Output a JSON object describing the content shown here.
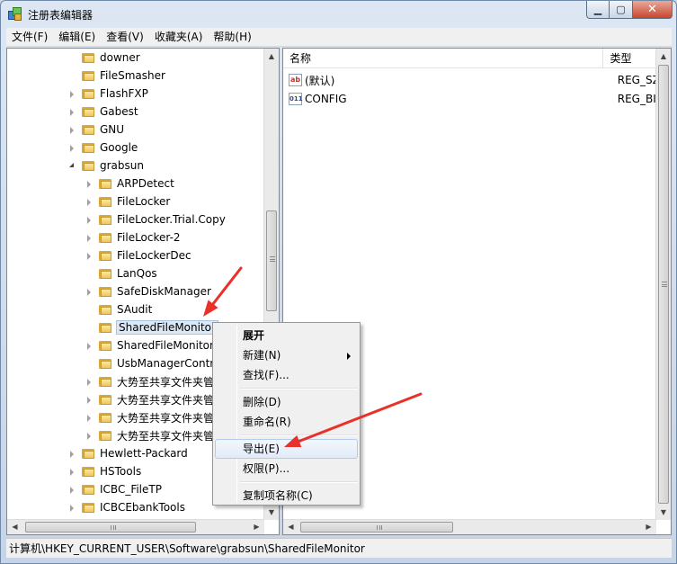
{
  "window": {
    "title": "注册表编辑器",
    "controls": {
      "minimize": "▁",
      "maximize": "▢",
      "close": "✕"
    }
  },
  "menubar": [
    {
      "label": "文件(F)"
    },
    {
      "label": "编辑(E)"
    },
    {
      "label": "查看(V)"
    },
    {
      "label": "收藏夹(A)"
    },
    {
      "label": "帮助(H)"
    }
  ],
  "tree": {
    "nodes": [
      {
        "label": "downer",
        "depth": 1,
        "expander": "none"
      },
      {
        "label": "FileSmasher",
        "depth": 1,
        "expander": "none"
      },
      {
        "label": "FlashFXP",
        "depth": 1,
        "expander": "collapsed"
      },
      {
        "label": "Gabest",
        "depth": 1,
        "expander": "collapsed"
      },
      {
        "label": "GNU",
        "depth": 1,
        "expander": "collapsed"
      },
      {
        "label": "Google",
        "depth": 1,
        "expander": "collapsed"
      },
      {
        "label": "grabsun",
        "depth": 1,
        "expander": "expanded"
      },
      {
        "label": "ARPDetect",
        "depth": 2,
        "expander": "collapsed"
      },
      {
        "label": "FileLocker",
        "depth": 2,
        "expander": "collapsed"
      },
      {
        "label": "FileLocker.Trial.Copy",
        "depth": 2,
        "expander": "collapsed"
      },
      {
        "label": "FileLocker-2",
        "depth": 2,
        "expander": "collapsed"
      },
      {
        "label": "FileLockerDec",
        "depth": 2,
        "expander": "collapsed"
      },
      {
        "label": "LanQos",
        "depth": 2,
        "expander": "none"
      },
      {
        "label": "SafeDiskManager",
        "depth": 2,
        "expander": "collapsed"
      },
      {
        "label": "SAudit",
        "depth": 2,
        "expander": "none"
      },
      {
        "label": "SharedFileMonitor",
        "depth": 2,
        "expander": "none",
        "selected": true
      },
      {
        "label": "SharedFileMonitor",
        "depth": 2,
        "expander": "collapsed"
      },
      {
        "label": "UsbManagerContr",
        "depth": 2,
        "expander": "none"
      },
      {
        "label": "大势至共享文件夹管",
        "depth": 2,
        "expander": "collapsed"
      },
      {
        "label": "大势至共享文件夹管",
        "depth": 2,
        "expander": "collapsed"
      },
      {
        "label": "大势至共享文件夹管",
        "depth": 2,
        "expander": "collapsed"
      },
      {
        "label": "大势至共享文件夹管",
        "depth": 2,
        "expander": "collapsed"
      },
      {
        "label": "Hewlett-Packard",
        "depth": 1,
        "expander": "collapsed"
      },
      {
        "label": "HSTools",
        "depth": 1,
        "expander": "collapsed"
      },
      {
        "label": "ICBC_FileTP",
        "depth": 1,
        "expander": "collapsed"
      },
      {
        "label": "ICBCEbankTools",
        "depth": 1,
        "expander": "collapsed"
      }
    ]
  },
  "list": {
    "columns": {
      "name": "名称",
      "type": "类型"
    },
    "rows": [
      {
        "icon": "string-value-icon",
        "icon_text": "ab",
        "name": "(默认)",
        "type": "REG_SZ"
      },
      {
        "icon": "binary-value-icon",
        "icon_text": "011",
        "name": "CONFIG",
        "type": "REG_BIN"
      }
    ]
  },
  "status": {
    "path": "计算机\\HKEY_CURRENT_USER\\Software\\grabsun\\SharedFileMonitor"
  },
  "context_menu": {
    "items": [
      {
        "label": "展开",
        "bold": true
      },
      {
        "label": "新建(N)",
        "submenu": true
      },
      {
        "label": "查找(F)..."
      },
      {
        "separator": true
      },
      {
        "label": "删除(D)"
      },
      {
        "label": "重命名(R)"
      },
      {
        "separator": true
      },
      {
        "label": "导出(E)",
        "highlighted": true
      },
      {
        "label": "权限(P)..."
      },
      {
        "separator": true
      },
      {
        "label": "复制项名称(C)"
      }
    ]
  },
  "annotation_color": "#e8312a"
}
